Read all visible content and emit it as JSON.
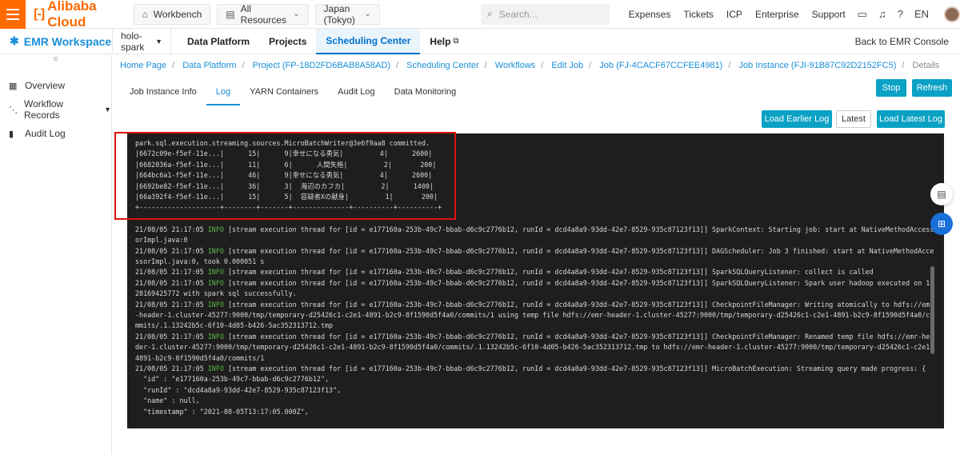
{
  "topbar": {
    "brand": "Alibaba Cloud",
    "brand_mark": "[-]",
    "workbench": "Workbench",
    "all_resources": "All Resources",
    "region": "Japan (Tokyo)",
    "search_placeholder": "Search...",
    "links": [
      "Expenses",
      "Tickets",
      "ICP",
      "Enterprise",
      "Support"
    ],
    "lang": "EN"
  },
  "subbar": {
    "workspace": "EMR Workspace",
    "project": "holo-spark",
    "tabs": [
      "Data Platform",
      "Projects",
      "Scheduling Center",
      "Help"
    ],
    "active_tab": "Scheduling Center",
    "back": "Back to EMR Console"
  },
  "sidebar": {
    "items": [
      {
        "label": "Overview",
        "icon": "grid-icon"
      },
      {
        "label": "Workflow Records",
        "icon": "workflow-icon"
      },
      {
        "label": "Audit Log",
        "icon": "document-icon"
      }
    ]
  },
  "breadcrumb": {
    "items": [
      "Home Page",
      "Data Platform",
      "Project (FP-18D2FD6BAB8A58AD)",
      "Scheduling Center",
      "Workflows",
      "Edit Job",
      "Job (FJ-4CACF67CCFEE4981)",
      "Job Instance (FJI-91B87C92D2152FC5)"
    ],
    "current": "Details"
  },
  "tabs": [
    "Job Instance Info",
    "Log",
    "YARN Containers",
    "Audit Log",
    "Data Monitoring"
  ],
  "active_tab": "Log",
  "buttons": {
    "stop": "Stop",
    "refresh": "Refresh",
    "load_earlier": "Load Earlier Log",
    "latest": "Latest",
    "load_latest": "Load Latest Log"
  },
  "log": {
    "table_lines": [
      "park.sql.execution.streaming.sources.MicroBatchWriter@3e6f9aa8 committed.",
      "|6672c09e-f5ef-11e...|      15|      9|幸せになる勇気|         4|      2600|",
      "|6682036a-f5ef-11e...|      11|      6|      人間失格|         2|       200|",
      "|664bc6a1-f5ef-11e...|      46|      9|幸せになる勇気|         4|      2600|",
      "|6692be82-f5ef-11e...|      36|      3|  海辺のカフカ|         2|      1400|",
      "|66a392f4-f5ef-11e...|      15|      5|  容疑者Xの献身|         1|       200|",
      "+--------------------+--------+-------+--------------+----------+----------+"
    ],
    "lines": [
      {
        "ts": "21/08/05 21:17:05 ",
        "level": "INFO",
        "msg": " [stream execution thread for [id = e177160a-253b-49c7-bbab-d6c9c2776b12, runId = dcd4a8a9-93dd-42e7-8529-935c87123f13]] SparkContext: Starting job: start at NativeMethodAccessorImpl.java:0"
      },
      {
        "ts": "21/08/05 21:17:05 ",
        "level": "INFO",
        "msg": " [stream execution thread for [id = e177160a-253b-49c7-bbab-d6c9c2776b12, runId = dcd4a8a9-93dd-42e7-8529-935c87123f13]] DAGScheduler: Job 3 finished: start at NativeMethodAccessorImpl.java:0, took 0.000051 s"
      },
      {
        "ts": "21/08/05 21:17:05 ",
        "level": "INFO",
        "msg": " [stream execution thread for [id = e177160a-253b-49c7-bbab-d6c9c2776b12, runId = dcd4a8a9-93dd-42e7-8529-935c87123f13]] SparkSQLQueryListener: collect is called"
      },
      {
        "ts": "21/08/05 21:17:05 ",
        "level": "INFO",
        "msg": " [stream execution thread for [id = e177160a-253b-49c7-bbab-d6c9c2776b12, runId = dcd4a8a9-93dd-42e7-8529-935c87123f13]] SparkSQLQueryListener: Spark user hadoop executed on 1628169425772 with spark sql successfully."
      },
      {
        "ts": "21/08/05 21:17:05 ",
        "level": "INFO",
        "msg": " [stream execution thread for [id = e177160a-253b-49c7-bbab-d6c9c2776b12, runId = dcd4a8a9-93dd-42e7-8529-935c87123f13]] CheckpointFileManager: Writing atomically to hdfs://emr-header-1.cluster-45277:9000/tmp/temporary-d25426c1-c2e1-4891-b2c9-8f1590d5f4a0/commits/1 using temp file hdfs://emr-header-1.cluster-45277:9000/tmp/temporary-d25426c1-c2e1-4891-b2c9-8f1590d5f4a0/commits/.1.13242b5c-6f10-4d05-b426-5ac352313712.tmp"
      },
      {
        "ts": "21/08/05 21:17:05 ",
        "level": "INFO",
        "msg": " [stream execution thread for [id = e177160a-253b-49c7-bbab-d6c9c2776b12, runId = dcd4a8a9-93dd-42e7-8529-935c87123f13]] CheckpointFileManager: Renamed temp file hdfs://emr-header-1.cluster-45277:9000/tmp/temporary-d25426c1-c2e1-4891-b2c9-8f1590d5f4a0/commits/.1.13242b5c-6f10-4d05-b426-5ac352313712.tmp to hdfs://emr-header-1.cluster-45277:9000/tmp/temporary-d25426c1-c2e1-4891-b2c9-8f1590d5f4a0/commits/1"
      },
      {
        "ts": "21/08/05 21:17:05 ",
        "level": "INFO",
        "msg": " [stream execution thread for [id = e177160a-253b-49c7-bbab-d6c9c2776b12, runId = dcd4a8a9-93dd-42e7-8529-935c87123f13]] MicroBatchExecution: Streaming query made progress: {"
      }
    ],
    "json_lines": [
      "  \"id\" : \"e177160a-253b-49c7-bbab-d6c9c2776b12\",",
      "  \"runId\" : \"dcd4a8a9-93dd-42e7-8529-935c87123f13\",",
      "  \"name\" : null,",
      "  \"timestamp\" : \"2021-08-05T13:17:05.000Z\","
    ]
  }
}
